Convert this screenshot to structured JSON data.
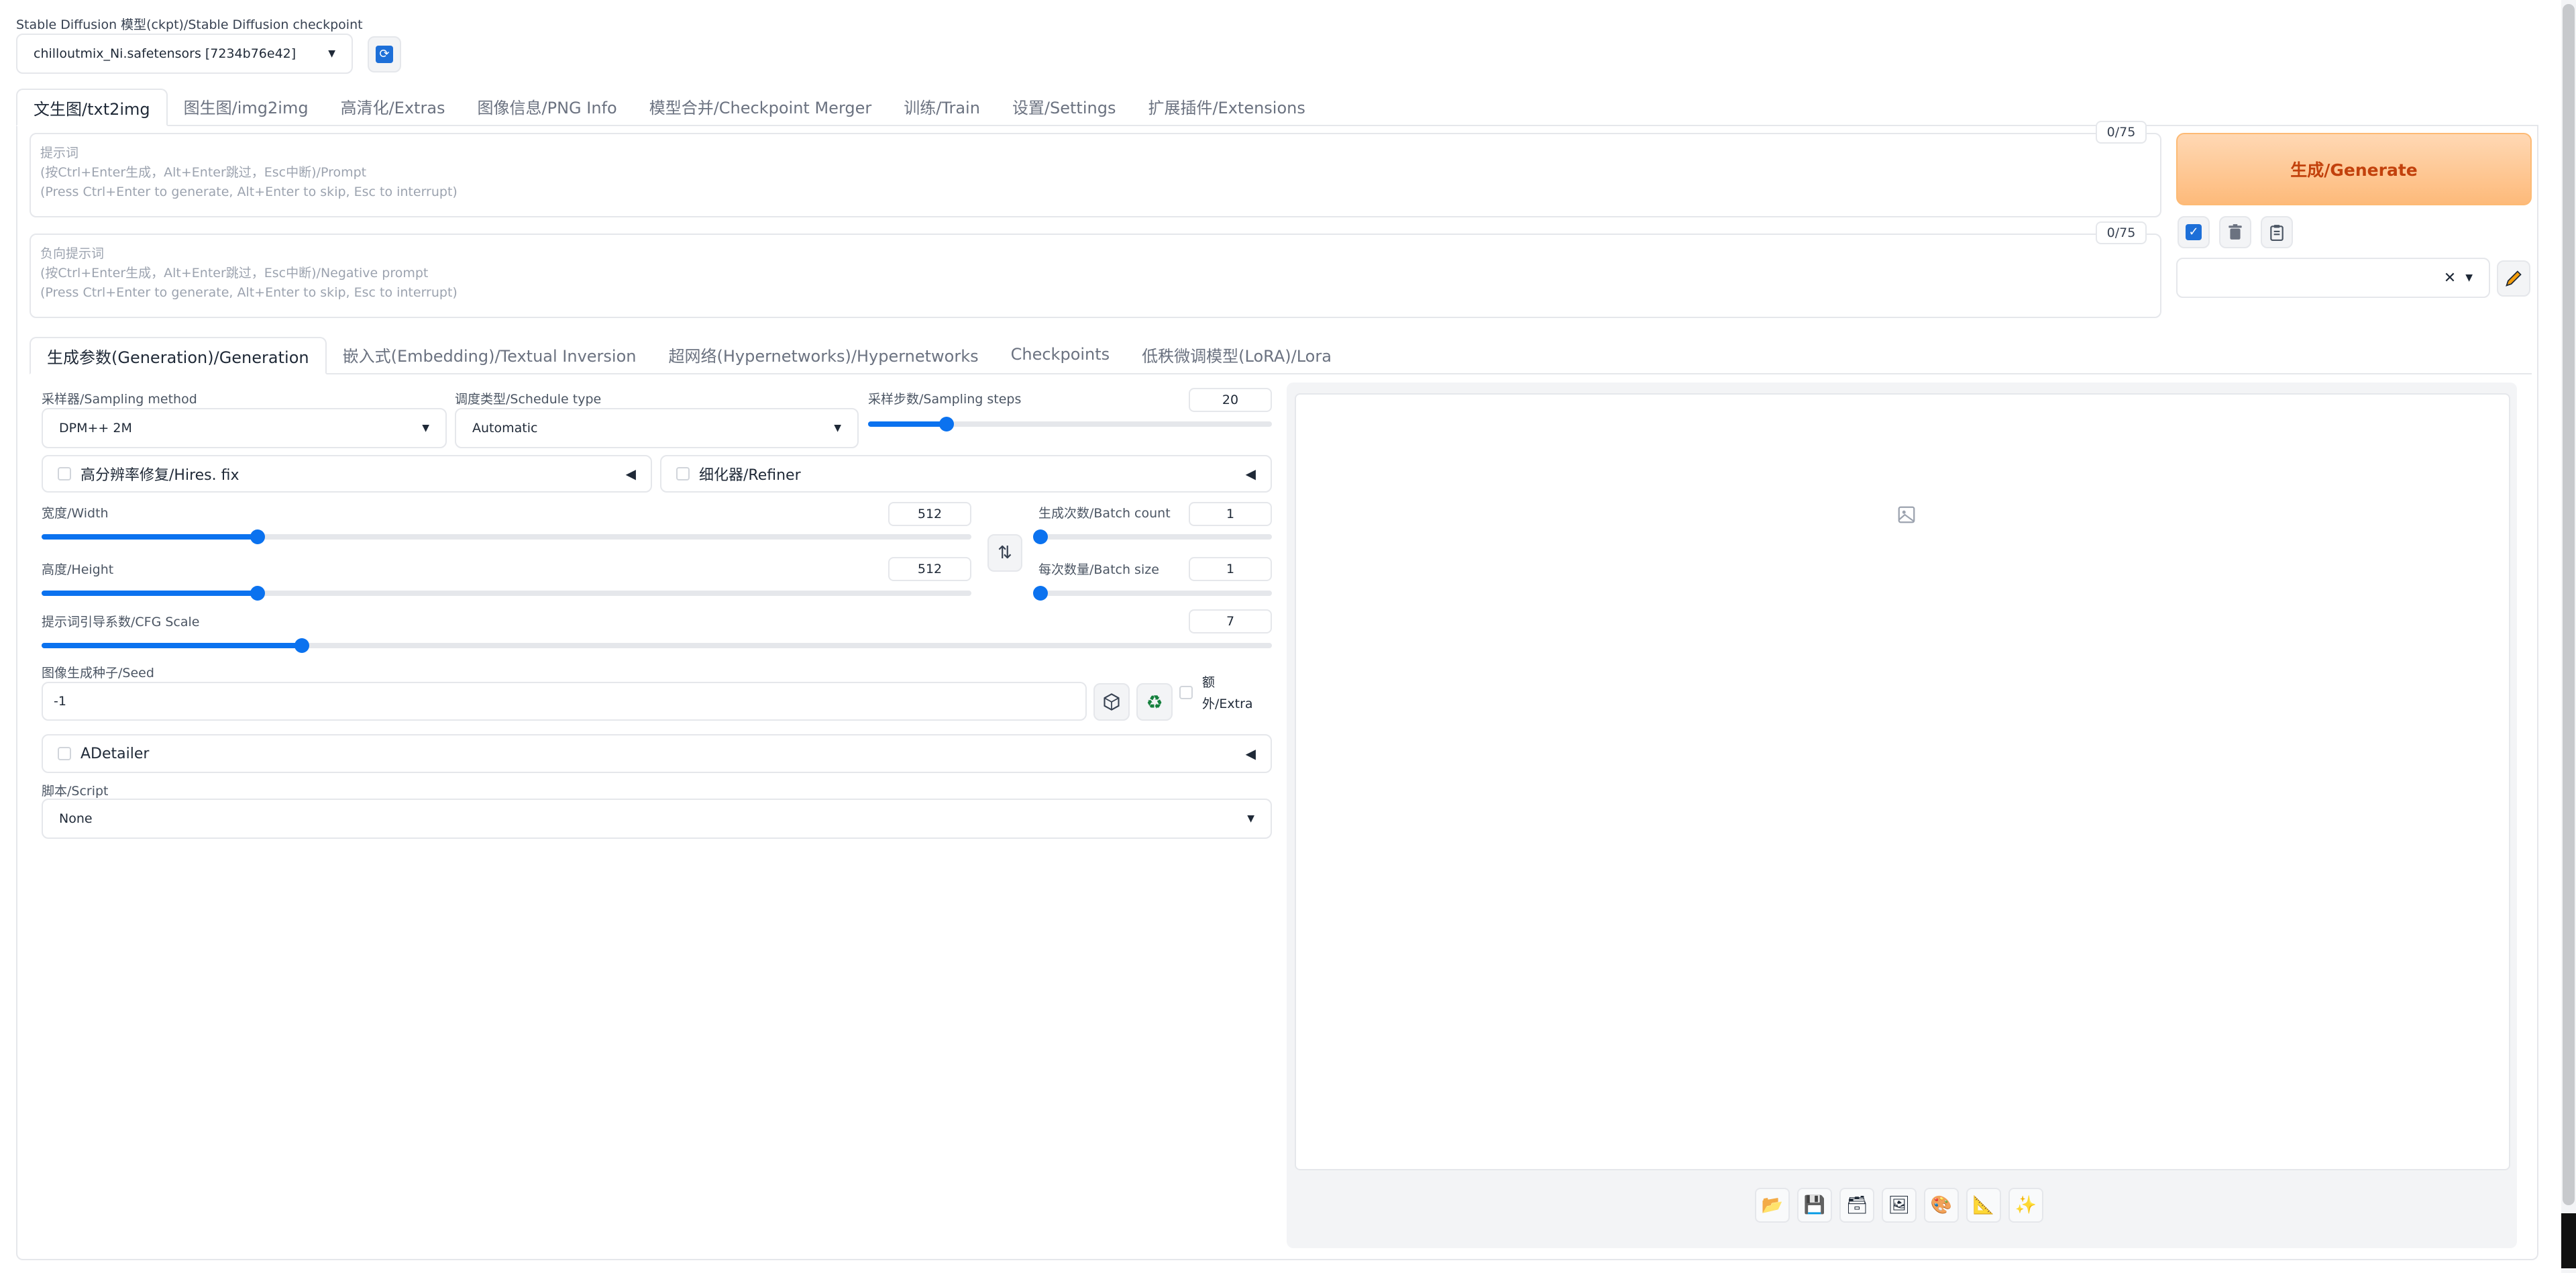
{
  "checkpoint": {
    "label": "Stable Diffusion 模型(ckpt)/Stable Diffusion checkpoint",
    "value": "chilloutmix_Ni.safetensors [7234b76e42]"
  },
  "main_tabs": [
    {
      "label": "文生图/txt2img",
      "selected": true
    },
    {
      "label": "图生图/img2img"
    },
    {
      "label": "高清化/Extras"
    },
    {
      "label": "图像信息/PNG Info"
    },
    {
      "label": "模型合并/Checkpoint Merger"
    },
    {
      "label": "训练/Train"
    },
    {
      "label": "设置/Settings"
    },
    {
      "label": "扩展插件/Extensions"
    }
  ],
  "prompt": {
    "placeholder_1": "提示词",
    "placeholder_2": "(按Ctrl+Enter生成，Alt+Enter跳过，Esc中断)/Prompt",
    "placeholder_3": "(Press Ctrl+Enter to generate, Alt+Enter to skip, Esc to interrupt)",
    "token_count": "0/75"
  },
  "negative_prompt": {
    "placeholder_1": "负向提示词",
    "placeholder_2": "(按Ctrl+Enter生成，Alt+Enter跳过，Esc中断)/Negative prompt",
    "placeholder_3": "(Press Ctrl+Enter to generate, Alt+Enter to skip, Esc to interrupt)",
    "token_count": "0/75"
  },
  "generate_label": "生成/Generate",
  "sub_tabs": [
    {
      "label": "生成参数(Generation)/Generation",
      "selected": true
    },
    {
      "label": "嵌入式(Embedding)/Textual Inversion"
    },
    {
      "label": "超网络(Hypernetworks)/Hypernetworks"
    },
    {
      "label": "Checkpoints"
    },
    {
      "label": "低秩微调模型(LoRA)/Lora"
    }
  ],
  "sampler": {
    "label": "采样器/Sampling method",
    "value": "DPM++ 2M"
  },
  "schedule": {
    "label": "调度类型/Schedule type",
    "value": "Automatic"
  },
  "steps": {
    "label": "采样步数/Sampling steps",
    "value": "20",
    "fraction": 0.19
  },
  "hires": {
    "label": "高分辨率修复/Hires. fix"
  },
  "refiner": {
    "label": "细化器/Refiner"
  },
  "width": {
    "label": "宽度/Width",
    "value": "512",
    "fraction": 0.23
  },
  "height": {
    "label": "高度/Height",
    "value": "512",
    "fraction": 0.23
  },
  "batch_count": {
    "label": "生成次数/Batch count",
    "value": "1",
    "fraction": 0.0
  },
  "batch_size": {
    "label": "每次数量/Batch size",
    "value": "1",
    "fraction": 0.0
  },
  "cfg": {
    "label": "提示词引导系数/CFG Scale",
    "value": "7",
    "fraction": 0.21
  },
  "seed": {
    "label": "图像生成种子/Seed",
    "value": "-1",
    "extra_label_1": "额",
    "extra_label_2": "外/Extra"
  },
  "adetailer": {
    "label": "ADetailer"
  },
  "script": {
    "label": "脚本/Script",
    "value": "None"
  },
  "colors": {
    "accent": "#0b72ef",
    "generate_text": "#c2410c",
    "generate_bg": "#fdba7a"
  }
}
